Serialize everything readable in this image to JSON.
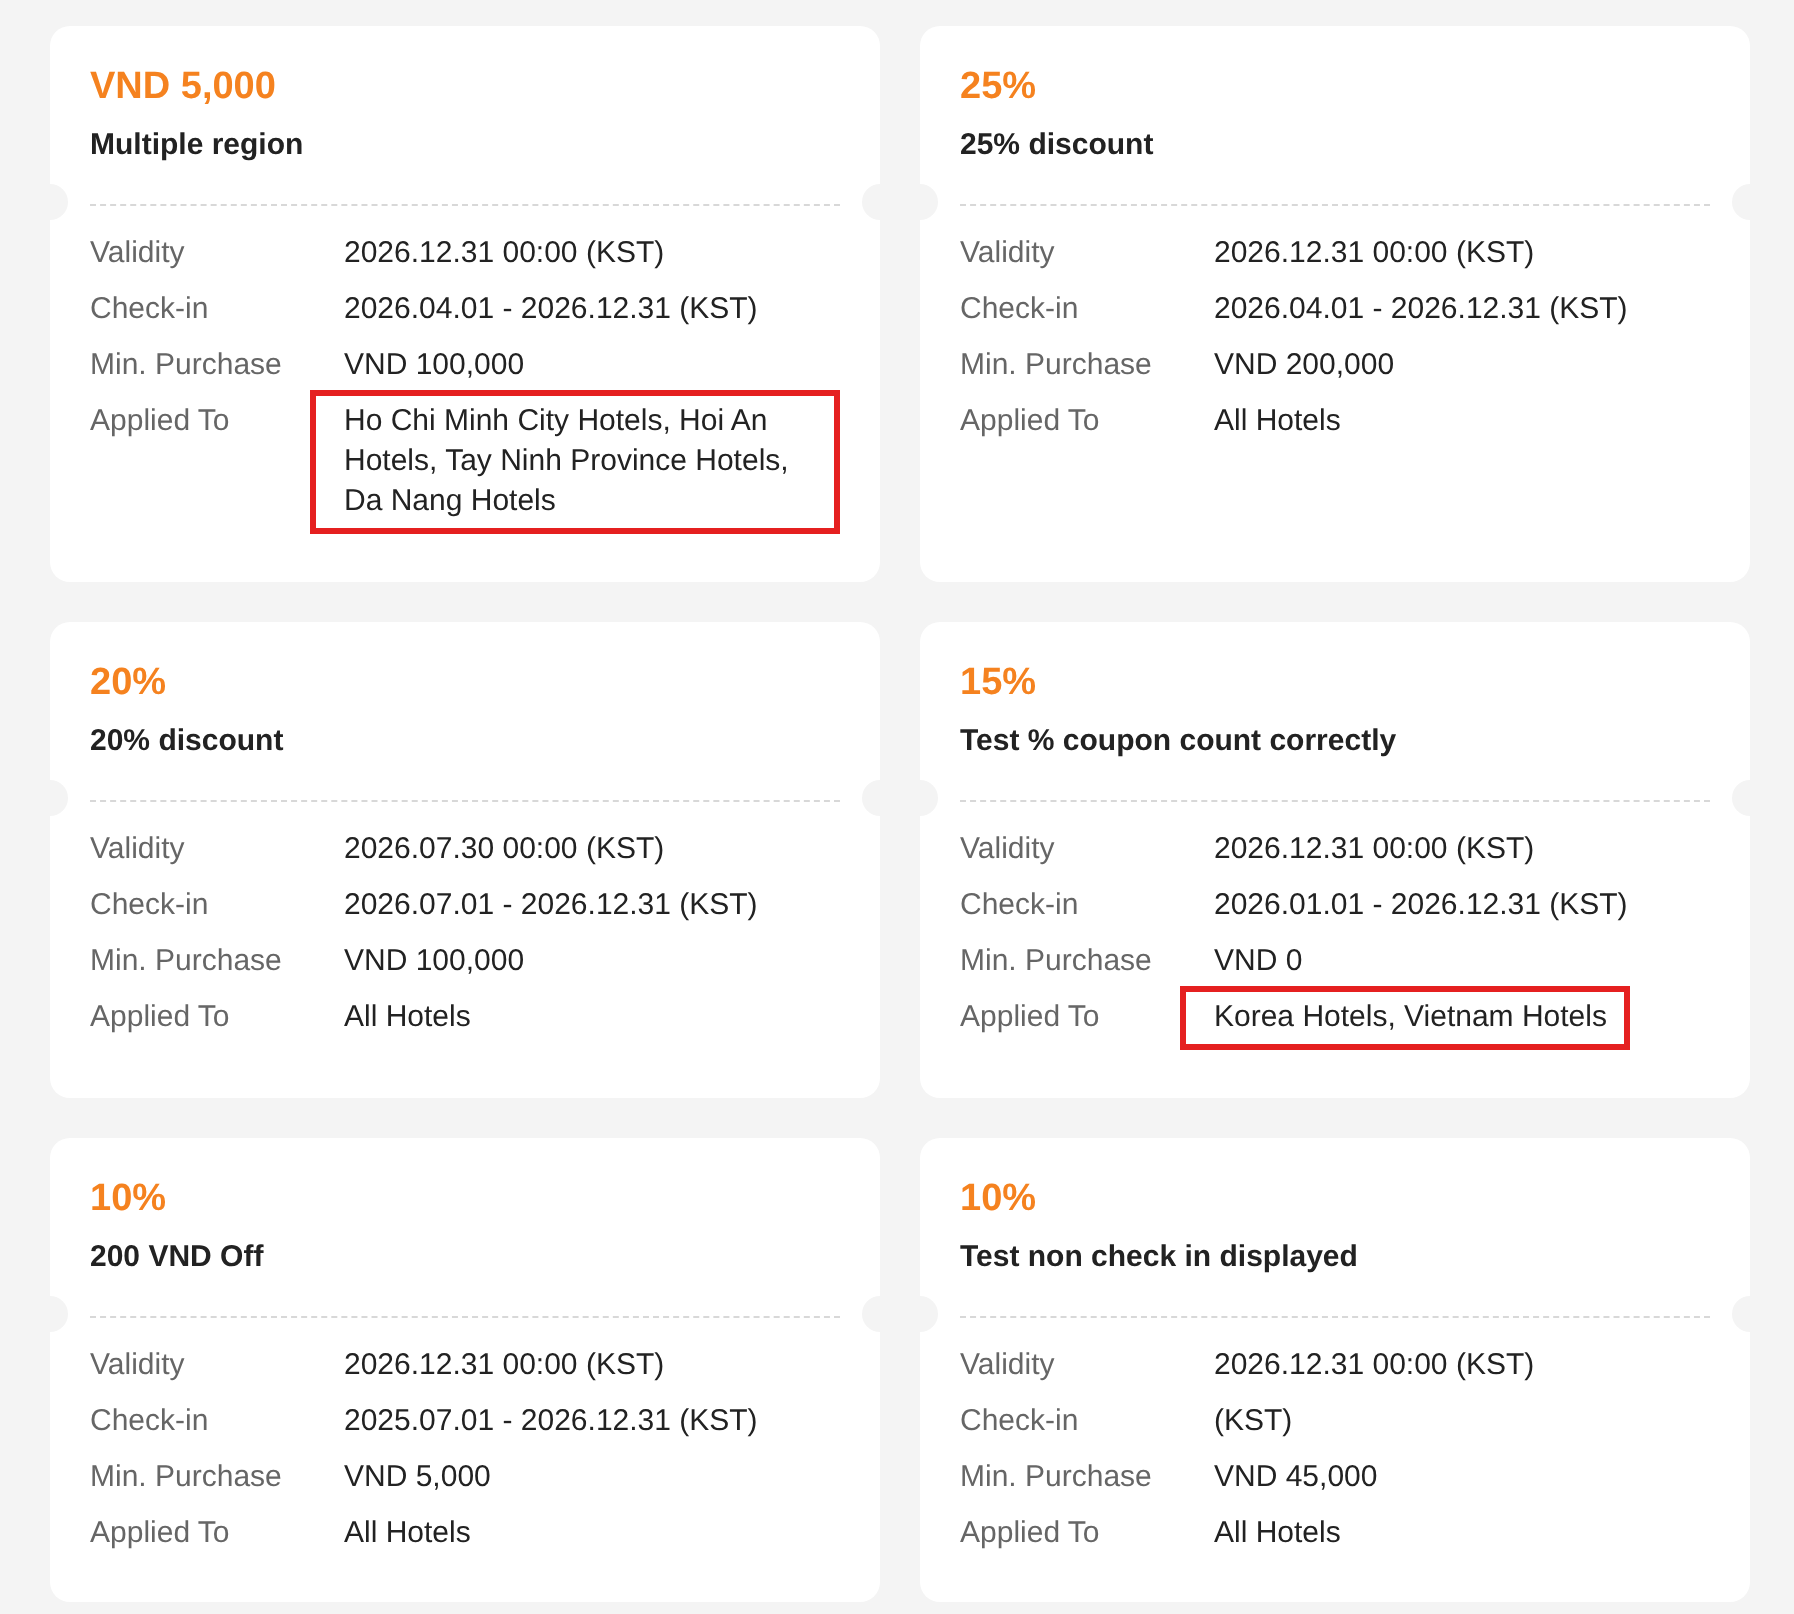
{
  "coupons": [
    {
      "amount": "VND 5,000",
      "title": "Multiple region",
      "details": [
        {
          "label": "Validity",
          "value": "2026.12.31 00:00 (KST)",
          "highlighted": false
        },
        {
          "label": "Check-in",
          "value": "2026.04.01 - 2026.12.31 (KST)",
          "highlighted": false
        },
        {
          "label": "Min. Purchase",
          "value": "VND 100,000",
          "highlighted": false
        },
        {
          "label": "Applied To",
          "value": "Ho Chi Minh City Hotels, Hoi An Hotels, Tay Ninh Province Hotels, Da Nang Hotels",
          "highlighted": true
        }
      ]
    },
    {
      "amount": "25%",
      "title": "25% discount",
      "details": [
        {
          "label": "Validity",
          "value": "2026.12.31 00:00 (KST)",
          "highlighted": false
        },
        {
          "label": "Check-in",
          "value": "2026.04.01 - 2026.12.31 (KST)",
          "highlighted": false
        },
        {
          "label": "Min. Purchase",
          "value": "VND 200,000",
          "highlighted": false
        },
        {
          "label": "Applied To",
          "value": "All Hotels",
          "highlighted": false
        }
      ]
    },
    {
      "amount": "20%",
      "title": "20% discount",
      "details": [
        {
          "label": "Validity",
          "value": "2026.07.30 00:00 (KST)",
          "highlighted": false
        },
        {
          "label": "Check-in",
          "value": "2026.07.01 - 2026.12.31 (KST)",
          "highlighted": false
        },
        {
          "label": "Min. Purchase",
          "value": "VND 100,000",
          "highlighted": false
        },
        {
          "label": "Applied To",
          "value": "All Hotels",
          "highlighted": false
        }
      ]
    },
    {
      "amount": "15%",
      "title": "Test % coupon count correctly",
      "details": [
        {
          "label": "Validity",
          "value": "2026.12.31 00:00 (KST)",
          "highlighted": false
        },
        {
          "label": "Check-in",
          "value": "2026.01.01 - 2026.12.31 (KST)",
          "highlighted": false
        },
        {
          "label": "Min. Purchase",
          "value": "VND 0",
          "highlighted": false
        },
        {
          "label": "Applied To",
          "value": "Korea Hotels, Vietnam Hotels",
          "highlighted": true
        }
      ]
    },
    {
      "amount": "10%",
      "title": "200 VND Off",
      "details": [
        {
          "label": "Validity",
          "value": "2026.12.31 00:00 (KST)",
          "highlighted": false
        },
        {
          "label": "Check-in",
          "value": "2025.07.01 - 2026.12.31 (KST)",
          "highlighted": false
        },
        {
          "label": "Min. Purchase",
          "value": "VND 5,000",
          "highlighted": false
        },
        {
          "label": "Applied To",
          "value": "All Hotels",
          "highlighted": false
        }
      ]
    },
    {
      "amount": "10%",
      "title": "Test non check in displayed",
      "details": [
        {
          "label": "Validity",
          "value": "2026.12.31 00:00 (KST)",
          "highlighted": false
        },
        {
          "label": "Check-in",
          "value": "(KST)",
          "highlighted": false
        },
        {
          "label": "Min. Purchase",
          "value": "VND 45,000",
          "highlighted": false
        },
        {
          "label": "Applied To",
          "value": "All Hotels",
          "highlighted": false
        }
      ]
    }
  ]
}
